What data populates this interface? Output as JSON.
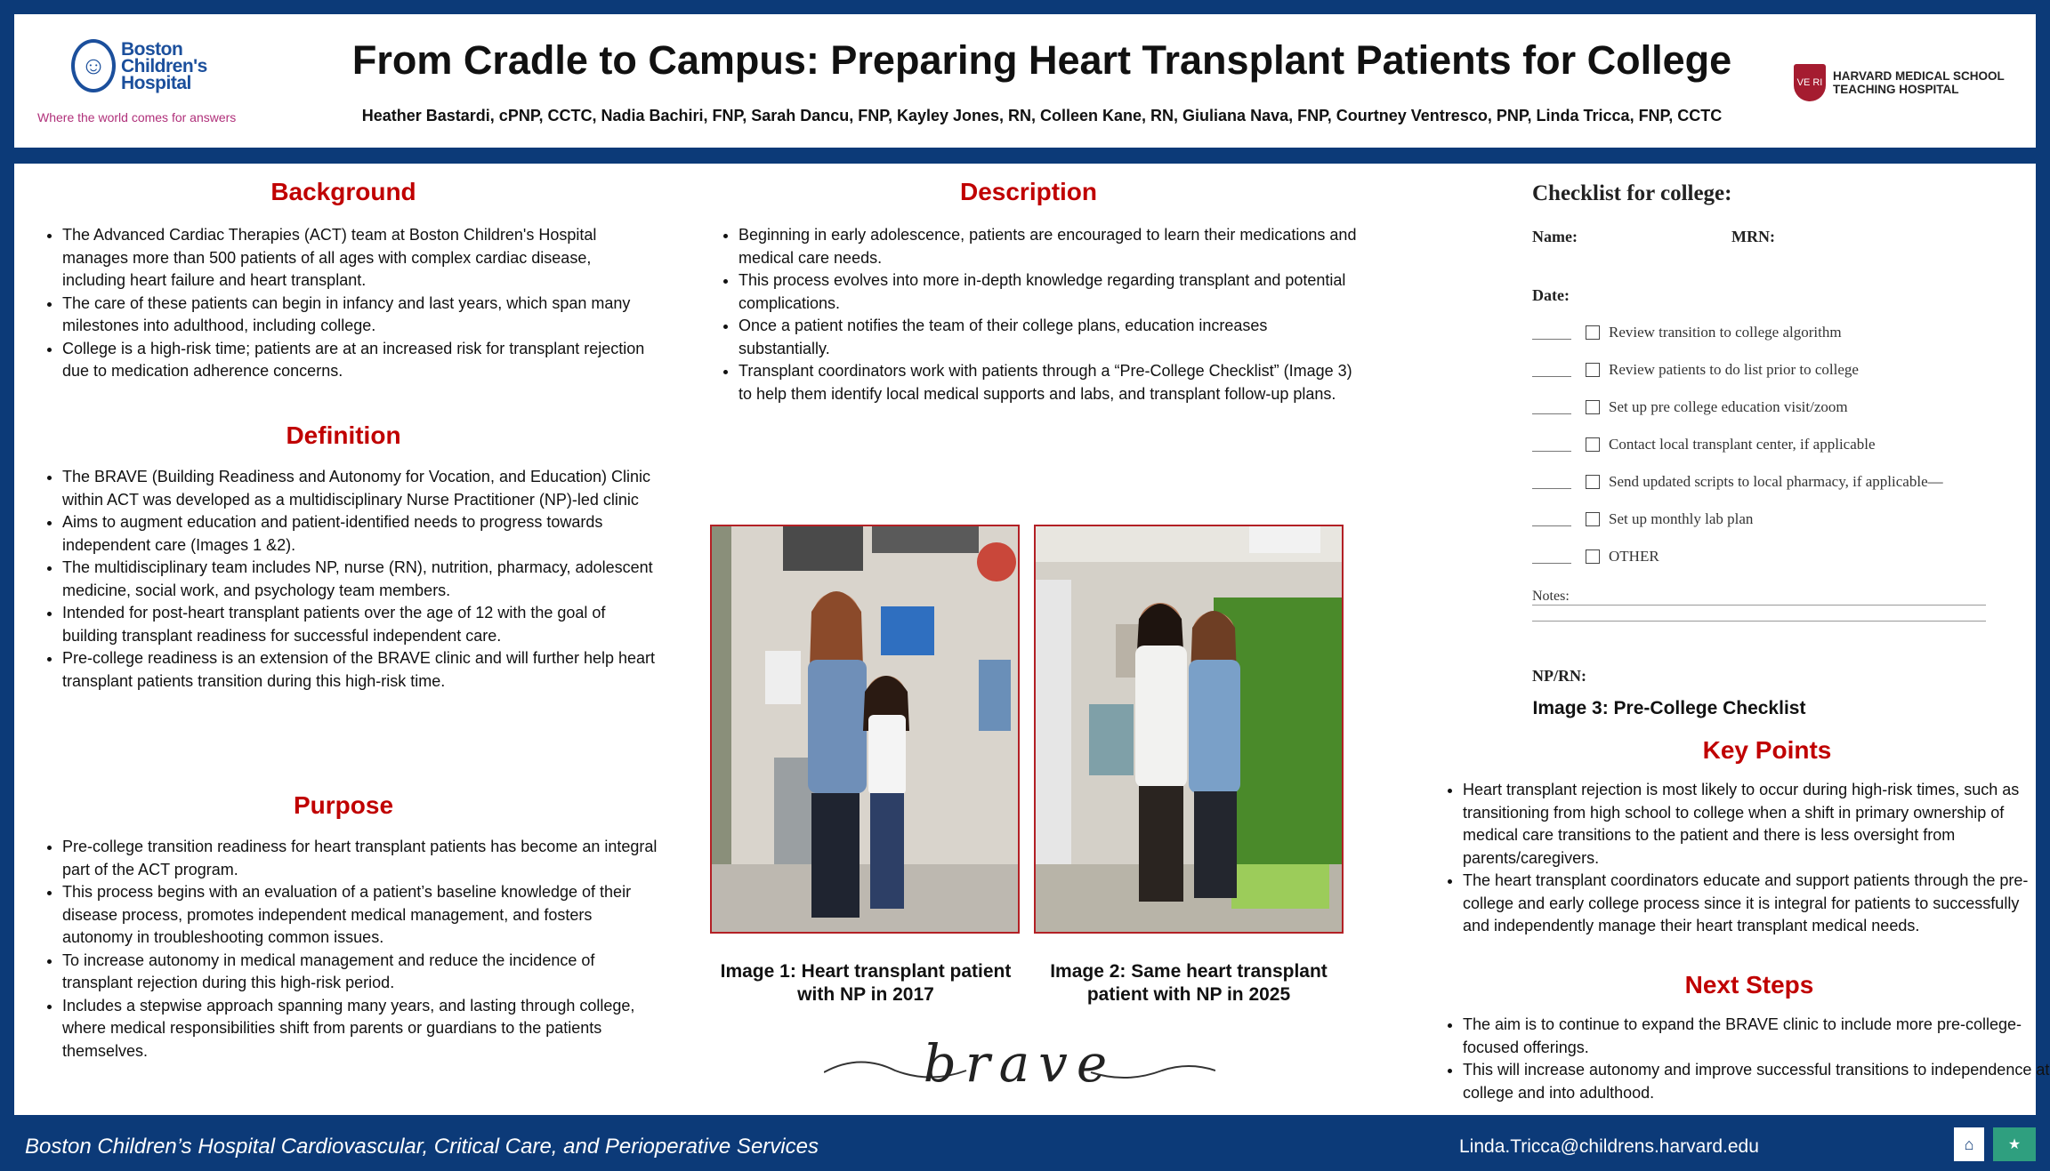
{
  "header": {
    "org_name": "Boston Children's Hospital",
    "org_tagline": "Where the world comes for answers",
    "title": "From Cradle to Campus: Preparing Heart Transplant Patients for College",
    "authors": "Heather Bastardi, cPNP, CCTC, Nadia Bachiri, FNP, Sarah Dancu, FNP, Kayley Jones, RN, Colleen Kane, RN, Giuliana Nava, FNP, Courtney Ventresco, PNP,  Linda Tricca, FNP, CCTC",
    "partner_name_line1": "HARVARD MEDICAL SCHOOL",
    "partner_name_line2": "TEACHING HOSPITAL"
  },
  "background": {
    "title": "Background",
    "items": [
      "The Advanced Cardiac Therapies (ACT) team at Boston Children's Hospital manages more than 500 patients of all ages with complex cardiac disease, including heart failure and heart transplant.",
      "The care of these patients can begin in infancy and last years, which span many milestones into adulthood, including college.",
      "College is a high-risk time; patients are at an increased risk for transplant rejection due to medication adherence concerns."
    ]
  },
  "definition": {
    "title": "Definition",
    "items": [
      "The BRAVE (Building Readiness and Autonomy for Vocation, and Education) Clinic within ACT was developed as a multidisciplinary Nurse Practitioner (NP)-led clinic",
      "Aims to augment education and patient-identified needs to progress towards independent care (Images 1 &2).",
      "The multidisciplinary team includes NP, nurse (RN), nutrition, pharmacy, adolescent medicine, social work, and psychology team members.",
      "Intended for post-heart transplant patients over the age of 12 with the goal of building transplant readiness for successful independent care.",
      "Pre-college readiness is an extension of the BRAVE clinic and will further help heart transplant patients transition during this high-risk time."
    ]
  },
  "purpose": {
    "title": "Purpose",
    "items": [
      "Pre-college transition readiness for heart transplant patients has become an integral part of the ACT program.",
      "This process begins with an evaluation of a patient’s baseline knowledge of their disease process, promotes independent medical management, and fosters autonomy in troubleshooting common issues.",
      "To increase autonomy in medical management and reduce the incidence of transplant rejection during this high-risk period.",
      "Includes a stepwise approach spanning many years, and lasting through college, where medical responsibilities shift from parents or guardians to the patients themselves."
    ]
  },
  "description": {
    "title": "Description",
    "items": [
      "Beginning in early adolescence, patients are encouraged to learn their medications and medical care needs.",
      "This process evolves into more in-depth knowledge regarding transplant and potential complications.",
      "Once a patient notifies the team of their college plans, education increases substantially.",
      "Transplant coordinators work with patients through a “Pre-College Checklist” (Image 3) to help them identify local medical supports and labs, and transplant follow-up plans."
    ]
  },
  "images": {
    "caption1": "Image 1: Heart transplant patient with NP in 2017",
    "caption2": "Image 2: Same heart transplant patient with NP in 2025",
    "signature": "brave"
  },
  "checklist": {
    "title": "Checklist for college:",
    "name_label": "Name:",
    "mrn_label": "MRN:",
    "date_label": "Date:",
    "items": [
      "Review transition to college algorithm",
      "Review patients to do list prior to college",
      "Set up pre college education visit/zoom",
      "Contact local transplant center, if applicable",
      "Send updated scripts to local pharmacy, if applicable—",
      "Set up monthly lab plan",
      "OTHER"
    ],
    "notes_label": "Notes:",
    "np_label": "NP/RN:",
    "caption": "Image 3: Pre-College Checklist"
  },
  "key_points": {
    "title": "Key Points",
    "items": [
      "Heart transplant rejection is most likely to occur during high-risk times, such as transitioning from high school to college when a shift in primary ownership of medical care transitions to the patient and there is less oversight from parents/caregivers.",
      "The heart transplant coordinators educate and support patients through the pre-college and early college process since it is integral for patients to successfully and independently manage their heart transplant medical needs."
    ]
  },
  "next_steps": {
    "title": "Next Steps",
    "items": [
      "The aim is to continue to expand the BRAVE clinic to include more pre-college-focused offerings.",
      "This will increase autonomy and improve successful transitions to independence at college and into adulthood."
    ]
  },
  "footer": {
    "left_text": "Boston Children’s Hospital Cardiovascular, Critical Care, and Perioperative Services",
    "email": "Linda.Tricca@childrens.harvard.edu"
  },
  "colors": {
    "navy": "#0c3a78",
    "heading_red": "#c00000",
    "photo_border": "#b32025"
  }
}
